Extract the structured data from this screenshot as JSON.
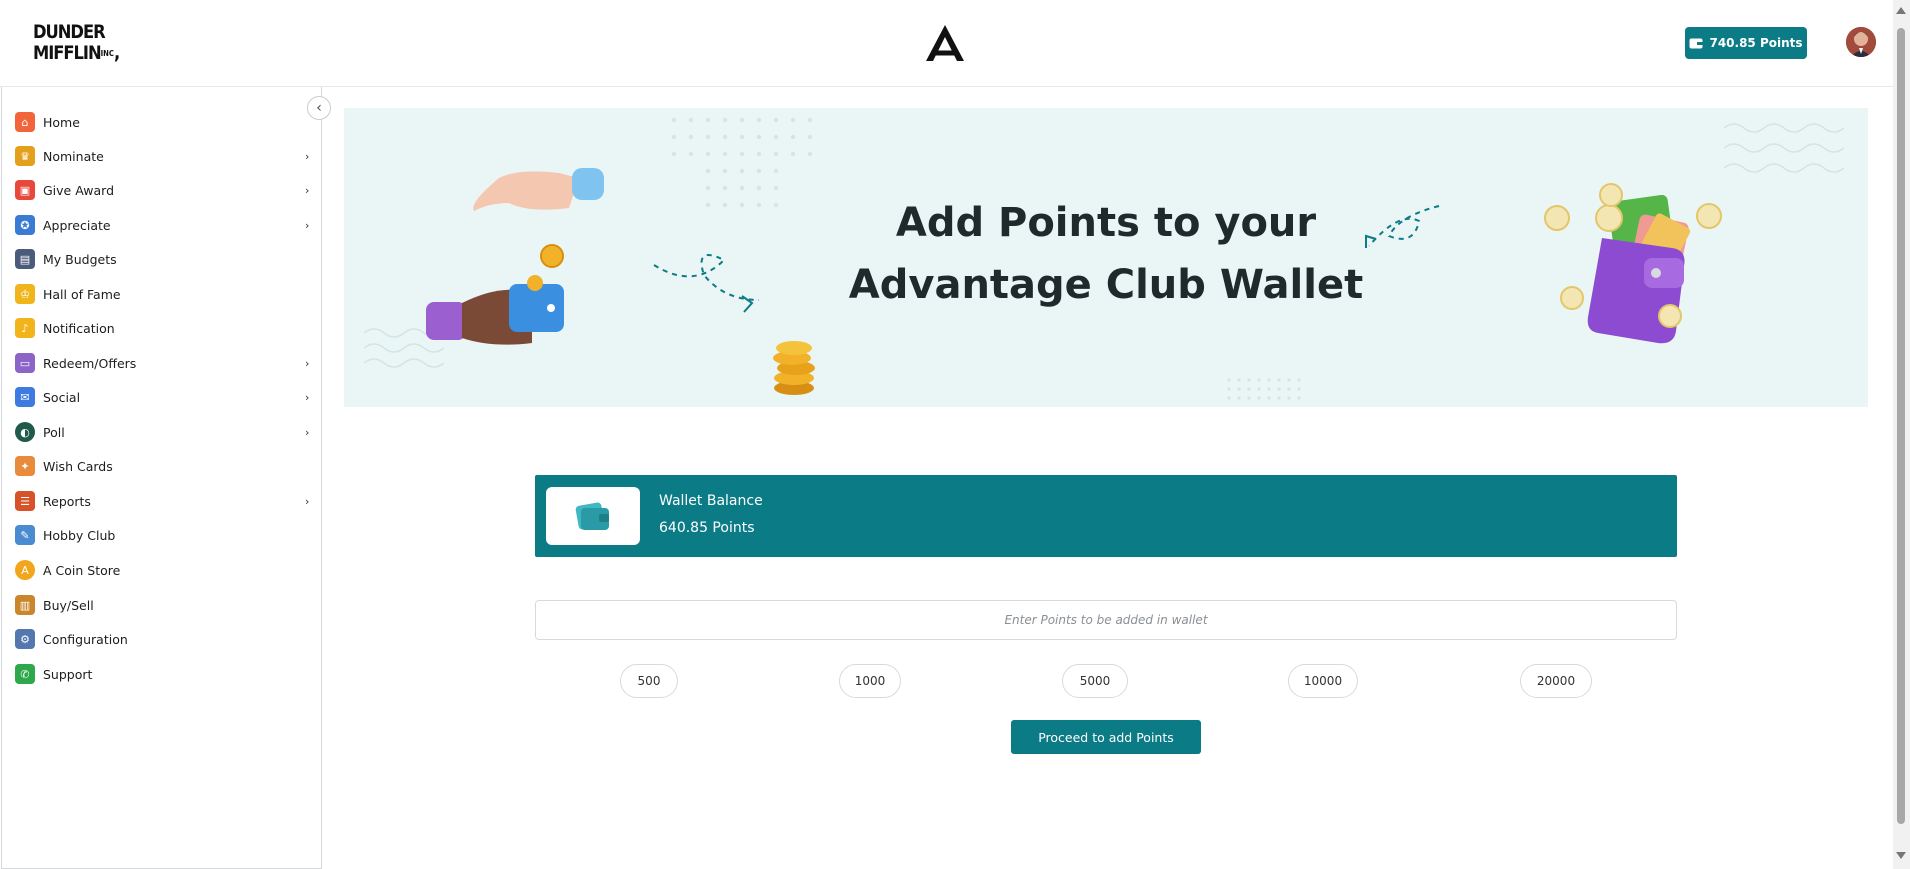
{
  "header": {
    "logo_text_line1": "DUNDER",
    "logo_text_line2": "MIFFLIN",
    "logo_text_suffix": "INC",
    "points_label": "740.85  Points"
  },
  "sidebar": {
    "items": [
      {
        "label": "Home",
        "icon": "home-icon",
        "color": "#f2653a",
        "chevron": false
      },
      {
        "label": "Nominate",
        "icon": "trophy-icon",
        "color": "#e3a01b",
        "chevron": true
      },
      {
        "label": "Give Award",
        "icon": "gift-icon",
        "color": "#e8483c",
        "chevron": true
      },
      {
        "label": "Appreciate",
        "icon": "medal-icon",
        "color": "#3a7bd5",
        "chevron": true
      },
      {
        "label": "My Budgets",
        "icon": "wallet-icon",
        "color": "#4a5b7c",
        "chevron": false
      },
      {
        "label": "Hall of Fame",
        "icon": "crown-icon",
        "color": "#f0b51b",
        "chevron": false
      },
      {
        "label": "Notification",
        "icon": "bell-icon",
        "color": "#f3b31a",
        "chevron": false
      },
      {
        "label": "Redeem/Offers",
        "icon": "card-icon",
        "color": "#8c63c7",
        "chevron": true
      },
      {
        "label": "Social",
        "icon": "chat-icon",
        "color": "#3e7be0",
        "chevron": true
      },
      {
        "label": "Poll",
        "icon": "poll-icon",
        "color": "#1f5a4a",
        "chevron": true
      },
      {
        "label": "Wish Cards",
        "icon": "party-icon",
        "color": "#e88b3b",
        "chevron": false
      },
      {
        "label": "Reports",
        "icon": "clipboard-icon",
        "color": "#d6532a",
        "chevron": true
      },
      {
        "label": "Hobby Club",
        "icon": "palette-icon",
        "color": "#4a8bd1",
        "chevron": false
      },
      {
        "label": "A Coin Store",
        "icon": "coin-icon",
        "color": "#f2a61b",
        "chevron": false
      },
      {
        "label": "Buy/Sell",
        "icon": "bags-icon",
        "color": "#c9862a",
        "chevron": false
      },
      {
        "label": "Configuration",
        "icon": "config-icon",
        "color": "#5577b0",
        "chevron": false
      },
      {
        "label": "Support",
        "icon": "phone-icon",
        "color": "#2ea84a",
        "chevron": false
      }
    ]
  },
  "banner": {
    "title_line1": "Add Points to your",
    "title_line2": "Advantage Club Wallet"
  },
  "wallet": {
    "label": "Wallet Balance",
    "value": "640.85 Points"
  },
  "form": {
    "placeholder": "Enter Points to be added in wallet",
    "presets": [
      "500",
      "1000",
      "5000",
      "10000",
      "20000"
    ],
    "proceed_label": "Proceed to add Points"
  },
  "colors": {
    "accent": "#0b7b86",
    "banner_bg": "#eaf5f5"
  }
}
